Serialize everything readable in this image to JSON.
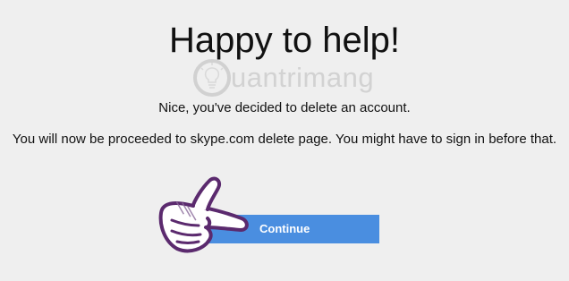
{
  "page": {
    "title": "Happy to help!",
    "subtitle": "Nice, you've decided to delete an account.",
    "message": "You will now be proceeded to skype.com delete page. You might have to sign in before that."
  },
  "watermark": {
    "text": "uantrimang",
    "icon": "lightbulb-icon"
  },
  "actions": {
    "continue_label": "Continue"
  },
  "overlay": {
    "icon": "pointing-hand-icon"
  },
  "colors": {
    "background": "#efefef",
    "button": "#4a8ee0",
    "button_text": "#ffffff",
    "hand_outline": "#5b2a6e",
    "watermark": "#cdcdcd"
  }
}
